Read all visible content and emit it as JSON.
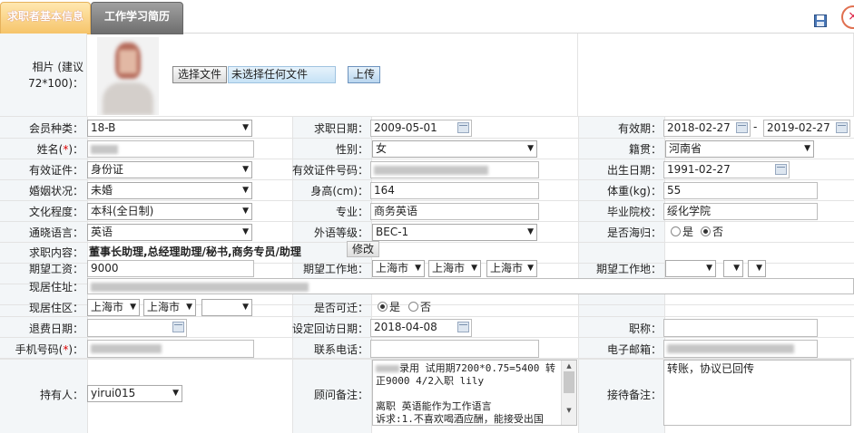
{
  "tabs": [
    "求职者基本信息",
    "工作学习简历"
  ],
  "close_glyph": "×",
  "photo": {
    "label": "相片 (建议\n72*100)：",
    "file_button": "选择文件",
    "file_status": "未选择任何文件",
    "upload_button": "上传"
  },
  "labels": {
    "member_type": "会员种类：",
    "apply_date": "求职日期：",
    "valid_period": "有效期：",
    "name": "姓名(",
    "name_star": "*",
    "name_tail": ")：",
    "gender": "性别：",
    "native_place": "籍贯：",
    "id_type": "有效证件：",
    "id_number": "有效证件号码：",
    "birth_date": "出生日期：",
    "marital": "婚姻状况：",
    "height": "身高(cm)：",
    "weight": "体重(kg)：",
    "education": "文化程度：",
    "major": "专业：",
    "school": "毕业院校：",
    "language": "通晓语言：",
    "foreign_level": "外语等级：",
    "overseas": "是否海归：",
    "job_content": "求职内容：",
    "salary": "期望工资：",
    "work_place1": "期望工作地：",
    "work_place2": "期望工作地：",
    "current_address": "现居住址：",
    "current_area": "现居住区：",
    "relocate": "是否可迁：",
    "refund_date": "退费日期：",
    "visit_date": "设定回访日期：",
    "title": "职称：",
    "phone": "手机号码(",
    "phone_star": "*",
    "phone_tail": ")：",
    "contact": "联系电话：",
    "email": "电子邮箱：",
    "holder": "持有人：",
    "consultant_note": "顾问备注：",
    "reception_note": "接待备注："
  },
  "values": {
    "member_type": "18-B",
    "apply_date": "2009-05-01",
    "valid_from": "2018-02-27",
    "valid_sep": "-",
    "valid_to": "2019-02-27",
    "gender": "女",
    "native_place": "河南省",
    "id_type": "身份证",
    "birth_date": "1991-02-27",
    "marital": "未婚",
    "height": "164",
    "weight": "55",
    "education": "本科(全日制)",
    "major": "商务英语",
    "school": "绥化学院",
    "language": "英语",
    "foreign_level": "BEC-1",
    "overseas_yes": "是",
    "overseas_no": "否",
    "job_content": "董事长助理,总经理助理/秘书,商务专员/助理",
    "modify_button": "修改",
    "salary": "9000",
    "wp1_a": "上海市",
    "wp1_b": "上海市",
    "wp1_c": "上海市",
    "area_a": "上海市",
    "area_b": "上海市",
    "relocate_yes": "是",
    "relocate_no": "否",
    "visit_date": "2018-04-08",
    "holder": "yirui015",
    "consultant_note": "录用 试用期7200*0.75=5400 转正9000 4/2入职 lily\n\n离职 英语能作为工作语言\n诉求:1.不喜欢喝酒应酬，能接受出国",
    "reception_note": "转账，协议已回传"
  }
}
